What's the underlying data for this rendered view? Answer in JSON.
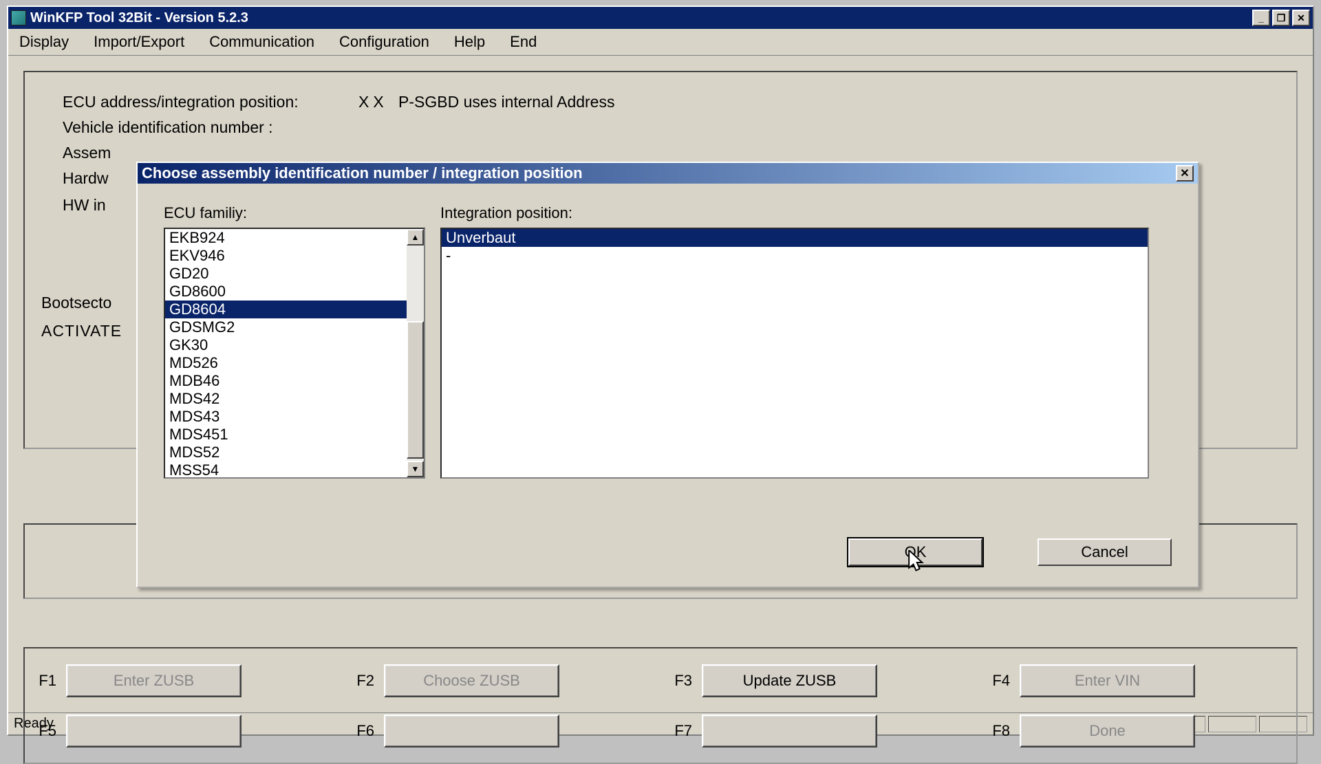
{
  "window": {
    "title": "WinKFP Tool 32Bit - Version 5.2.3"
  },
  "menubar": {
    "items": [
      "Display",
      "Import/Export",
      "Communication",
      "Configuration",
      "Help",
      "End"
    ]
  },
  "info": {
    "ecu_addr_label": "ECU address/integration position:",
    "ecu_addr_xx": "XX",
    "ecu_addr_msg": "P-SGBD uses internal Address",
    "vin_label": "Vehicle identification number :",
    "assem_label": "Assem",
    "hardw_label": "Hardw",
    "hwin_label": "HW in",
    "boot_label": "Bootsecto",
    "activate_label": "ACTIVATE"
  },
  "dialog": {
    "title": "Choose assembly identification number / integration position",
    "ecu_family_label": "ECU familiy:",
    "integration_label": "Integration position:",
    "ecu_list": [
      "EKB924",
      "EKV946",
      "GD20",
      "GD8600",
      "GD8604",
      "GDSMG2",
      "GK30",
      "MD526",
      "MDB46",
      "MDS42",
      "MDS43",
      "MDS451",
      "MDS52",
      "MSS54"
    ],
    "ecu_selected_index": 4,
    "integration_list": [
      "Unverbaut",
      "-"
    ],
    "integration_selected_index": 0,
    "ok_label": "OK",
    "cancel_label": "Cancel"
  },
  "fkeys": {
    "rows": [
      {
        "key": "F1",
        "label": "Enter ZUSB",
        "enabled": false
      },
      {
        "key": "F2",
        "label": "Choose ZUSB",
        "enabled": false
      },
      {
        "key": "F3",
        "label": "Update ZUSB",
        "enabled": true
      },
      {
        "key": "F4",
        "label": "Enter VIN",
        "enabled": false
      },
      {
        "key": "F5",
        "label": "",
        "enabled": false
      },
      {
        "key": "F6",
        "label": "",
        "enabled": false
      },
      {
        "key": "F7",
        "label": "",
        "enabled": false
      },
      {
        "key": "F8",
        "label": "Done",
        "enabled": false
      }
    ]
  },
  "status": {
    "text": "Ready"
  }
}
